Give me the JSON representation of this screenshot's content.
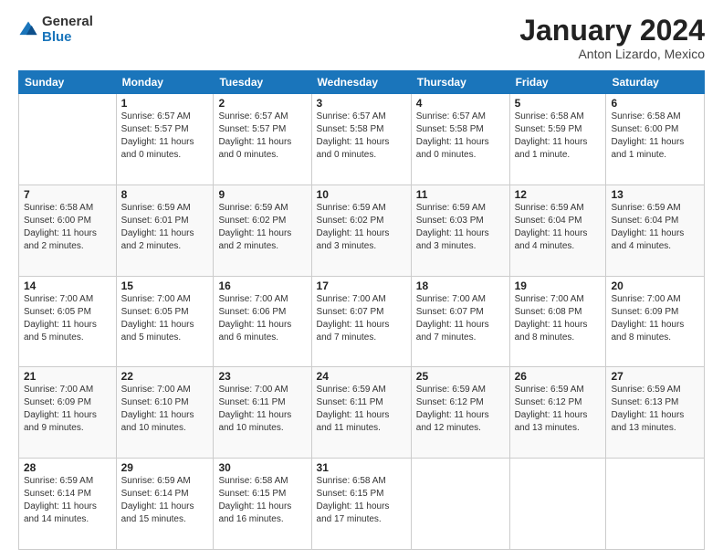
{
  "logo": {
    "general": "General",
    "blue": "Blue"
  },
  "title": {
    "month": "January 2024",
    "location": "Anton Lizardo, Mexico"
  },
  "weekdays": [
    "Sunday",
    "Monday",
    "Tuesday",
    "Wednesday",
    "Thursday",
    "Friday",
    "Saturday"
  ],
  "weeks": [
    [
      {
        "day": "",
        "info": ""
      },
      {
        "day": "1",
        "info": "Sunrise: 6:57 AM\nSunset: 5:57 PM\nDaylight: 11 hours\nand 0 minutes."
      },
      {
        "day": "2",
        "info": "Sunrise: 6:57 AM\nSunset: 5:57 PM\nDaylight: 11 hours\nand 0 minutes."
      },
      {
        "day": "3",
        "info": "Sunrise: 6:57 AM\nSunset: 5:58 PM\nDaylight: 11 hours\nand 0 minutes."
      },
      {
        "day": "4",
        "info": "Sunrise: 6:57 AM\nSunset: 5:58 PM\nDaylight: 11 hours\nand 0 minutes."
      },
      {
        "day": "5",
        "info": "Sunrise: 6:58 AM\nSunset: 5:59 PM\nDaylight: 11 hours\nand 1 minute."
      },
      {
        "day": "6",
        "info": "Sunrise: 6:58 AM\nSunset: 6:00 PM\nDaylight: 11 hours\nand 1 minute."
      }
    ],
    [
      {
        "day": "7",
        "info": "Sunrise: 6:58 AM\nSunset: 6:00 PM\nDaylight: 11 hours\nand 2 minutes."
      },
      {
        "day": "8",
        "info": "Sunrise: 6:59 AM\nSunset: 6:01 PM\nDaylight: 11 hours\nand 2 minutes."
      },
      {
        "day": "9",
        "info": "Sunrise: 6:59 AM\nSunset: 6:02 PM\nDaylight: 11 hours\nand 2 minutes."
      },
      {
        "day": "10",
        "info": "Sunrise: 6:59 AM\nSunset: 6:02 PM\nDaylight: 11 hours\nand 3 minutes."
      },
      {
        "day": "11",
        "info": "Sunrise: 6:59 AM\nSunset: 6:03 PM\nDaylight: 11 hours\nand 3 minutes."
      },
      {
        "day": "12",
        "info": "Sunrise: 6:59 AM\nSunset: 6:04 PM\nDaylight: 11 hours\nand 4 minutes."
      },
      {
        "day": "13",
        "info": "Sunrise: 6:59 AM\nSunset: 6:04 PM\nDaylight: 11 hours\nand 4 minutes."
      }
    ],
    [
      {
        "day": "14",
        "info": "Sunrise: 7:00 AM\nSunset: 6:05 PM\nDaylight: 11 hours\nand 5 minutes."
      },
      {
        "day": "15",
        "info": "Sunrise: 7:00 AM\nSunset: 6:05 PM\nDaylight: 11 hours\nand 5 minutes."
      },
      {
        "day": "16",
        "info": "Sunrise: 7:00 AM\nSunset: 6:06 PM\nDaylight: 11 hours\nand 6 minutes."
      },
      {
        "day": "17",
        "info": "Sunrise: 7:00 AM\nSunset: 6:07 PM\nDaylight: 11 hours\nand 7 minutes."
      },
      {
        "day": "18",
        "info": "Sunrise: 7:00 AM\nSunset: 6:07 PM\nDaylight: 11 hours\nand 7 minutes."
      },
      {
        "day": "19",
        "info": "Sunrise: 7:00 AM\nSunset: 6:08 PM\nDaylight: 11 hours\nand 8 minutes."
      },
      {
        "day": "20",
        "info": "Sunrise: 7:00 AM\nSunset: 6:09 PM\nDaylight: 11 hours\nand 8 minutes."
      }
    ],
    [
      {
        "day": "21",
        "info": "Sunrise: 7:00 AM\nSunset: 6:09 PM\nDaylight: 11 hours\nand 9 minutes."
      },
      {
        "day": "22",
        "info": "Sunrise: 7:00 AM\nSunset: 6:10 PM\nDaylight: 11 hours\nand 10 minutes."
      },
      {
        "day": "23",
        "info": "Sunrise: 7:00 AM\nSunset: 6:11 PM\nDaylight: 11 hours\nand 10 minutes."
      },
      {
        "day": "24",
        "info": "Sunrise: 6:59 AM\nSunset: 6:11 PM\nDaylight: 11 hours\nand 11 minutes."
      },
      {
        "day": "25",
        "info": "Sunrise: 6:59 AM\nSunset: 6:12 PM\nDaylight: 11 hours\nand 12 minutes."
      },
      {
        "day": "26",
        "info": "Sunrise: 6:59 AM\nSunset: 6:12 PM\nDaylight: 11 hours\nand 13 minutes."
      },
      {
        "day": "27",
        "info": "Sunrise: 6:59 AM\nSunset: 6:13 PM\nDaylight: 11 hours\nand 13 minutes."
      }
    ],
    [
      {
        "day": "28",
        "info": "Sunrise: 6:59 AM\nSunset: 6:14 PM\nDaylight: 11 hours\nand 14 minutes."
      },
      {
        "day": "29",
        "info": "Sunrise: 6:59 AM\nSunset: 6:14 PM\nDaylight: 11 hours\nand 15 minutes."
      },
      {
        "day": "30",
        "info": "Sunrise: 6:58 AM\nSunset: 6:15 PM\nDaylight: 11 hours\nand 16 minutes."
      },
      {
        "day": "31",
        "info": "Sunrise: 6:58 AM\nSunset: 6:15 PM\nDaylight: 11 hours\nand 17 minutes."
      },
      {
        "day": "",
        "info": ""
      },
      {
        "day": "",
        "info": ""
      },
      {
        "day": "",
        "info": ""
      }
    ]
  ]
}
